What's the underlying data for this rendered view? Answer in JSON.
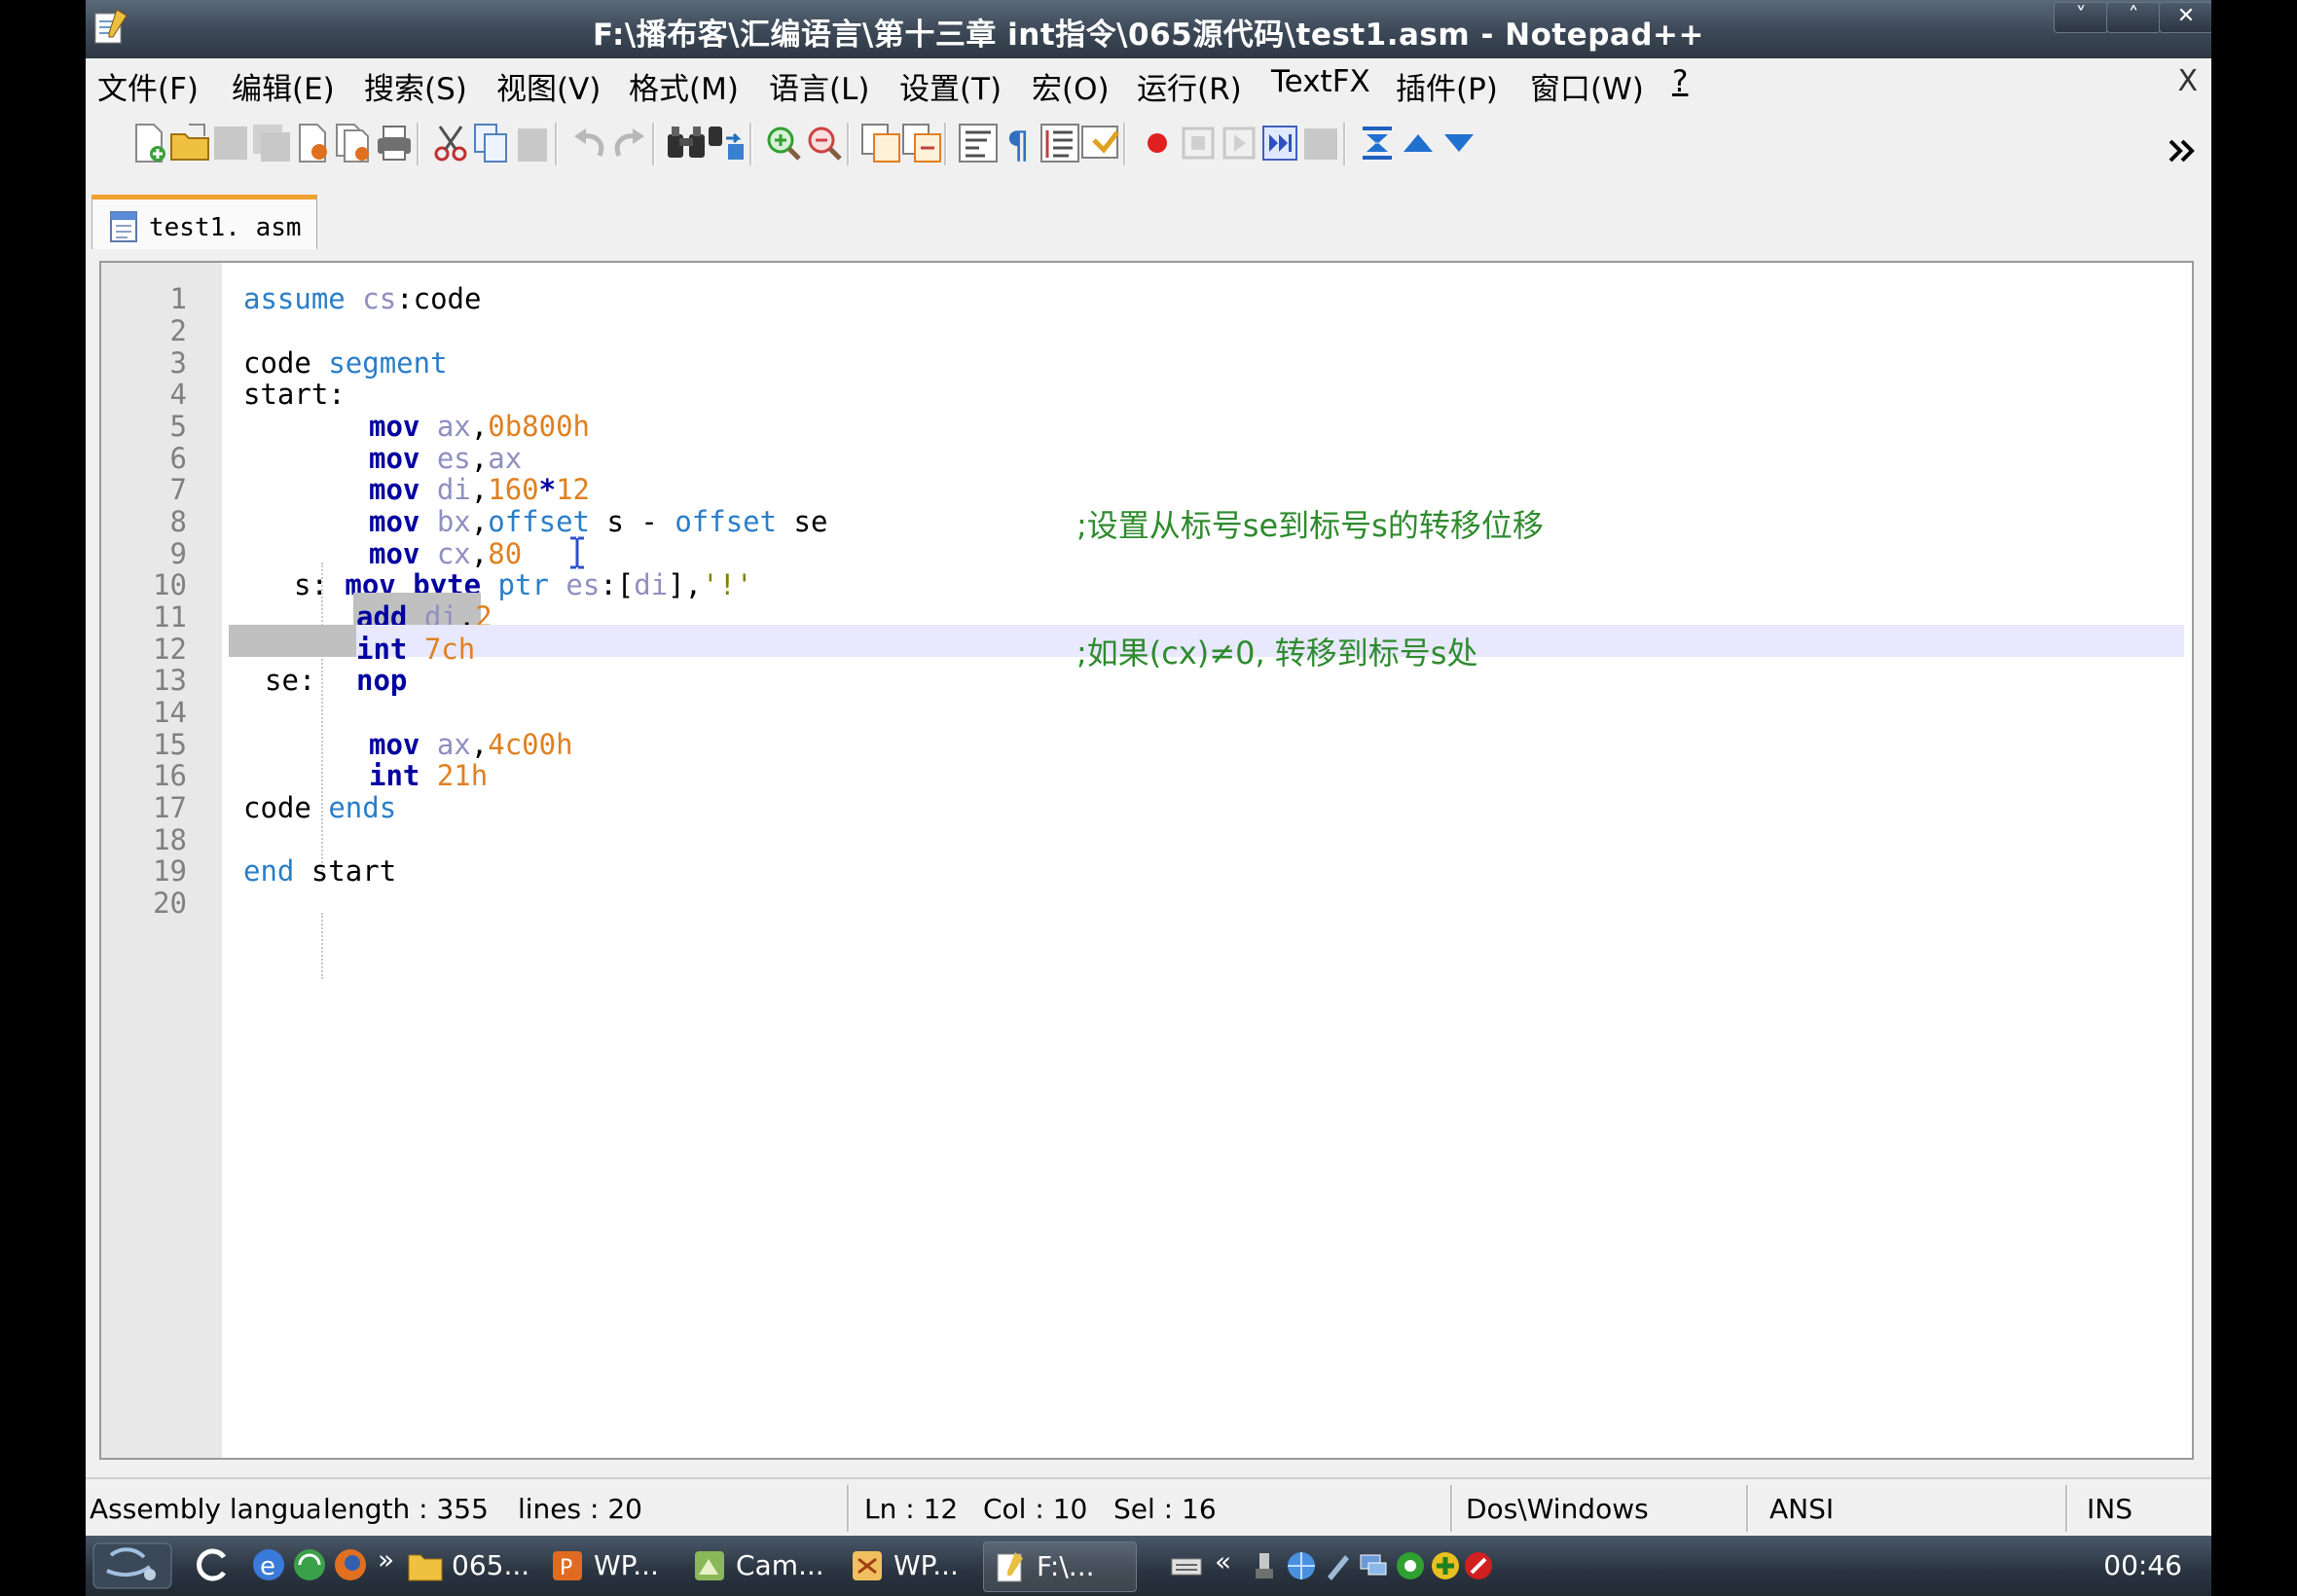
{
  "window": {
    "title": "F:\\播布客\\汇编语言\\第十三章 int指令\\065源代码\\test1.asm - Notepad++",
    "buttons": {
      "minimize": "˅",
      "maximize": "˄",
      "close": "✕"
    }
  },
  "menu": {
    "items": [
      "文件(F)",
      "编辑(E)",
      "搜索(S)",
      "视图(V)",
      "格式(M)",
      "语言(L)",
      "设置(T)",
      "宏(O)",
      "运行(R)",
      "TextFX",
      "插件(P)",
      "窗口(W)",
      "?"
    ],
    "close": "X"
  },
  "tabs": [
    {
      "label": "test1. asm",
      "active": true
    }
  ],
  "editor": {
    "language": "assembly",
    "current_line": 12,
    "lines": [
      {
        "n": "1"
      },
      {
        "n": "2"
      },
      {
        "n": "3"
      },
      {
        "n": "4"
      },
      {
        "n": "5"
      },
      {
        "n": "6"
      },
      {
        "n": "7"
      },
      {
        "n": "8"
      },
      {
        "n": "9"
      },
      {
        "n": "10"
      },
      {
        "n": "11"
      },
      {
        "n": "12"
      },
      {
        "n": "13"
      },
      {
        "n": "14"
      },
      {
        "n": "15"
      },
      {
        "n": "16"
      },
      {
        "n": "17"
      },
      {
        "n": "18"
      },
      {
        "n": "19"
      },
      {
        "n": "20"
      }
    ],
    "tokens": {
      "l1": [
        "assume",
        "cs",
        ":code"
      ],
      "l3": [
        "code ",
        "segment"
      ],
      "l4": [
        "start:"
      ],
      "l5": [
        "mov ",
        "ax",
        ",",
        "0b800h"
      ],
      "l6": [
        "mov ",
        "es",
        ",",
        "ax"
      ],
      "l7": [
        "mov ",
        "di",
        ",",
        "160",
        "*",
        "12"
      ],
      "l8": [
        "mov ",
        "bx",
        ",",
        "offset",
        " s - ",
        "offset",
        " se",
        ";设置从标号se到标号s的转移位移"
      ],
      "l9": [
        "mov ",
        "cx",
        ",",
        "80"
      ],
      "l10": [
        "s: ",
        "mov ",
        "byte ",
        "ptr",
        " ",
        "es",
        ":[",
        "di",
        "],",
        "'!'"
      ],
      "l11": [
        "add ",
        "di",
        ",",
        "2"
      ],
      "l12": [
        "int ",
        "7ch",
        ";如果(cx)≠0, 转移到标号s处"
      ],
      "l13": [
        "se:",
        "nop"
      ],
      "l15": [
        "mov ",
        "ax",
        ",",
        "4c00h"
      ],
      "l16": [
        "int ",
        "21h"
      ],
      "l17": [
        "code ",
        "ends"
      ],
      "l19": [
        "end",
        " start"
      ]
    }
  },
  "statusbar": {
    "lang": "Assembly languag",
    "length": "length : 355",
    "lines": "lines : 20",
    "ln": "Ln : 12",
    "col": "Col : 10",
    "sel": "Sel : 16",
    "eol": "Dos\\Windows",
    "encoding": "ANSI",
    "mode": "INS"
  },
  "taskbar": {
    "tasks": [
      "065...",
      "WP...",
      "Cam...",
      "WP...",
      "F:\\..."
    ],
    "overflow": "»",
    "tray_overflow": "«",
    "clock": "00:46"
  },
  "colors": {
    "keyword": "#0000a0",
    "type": "#2a7ec8",
    "register": "#8f8fc0",
    "number": "#e08020",
    "comment": "#2e8b2e",
    "current_line": "#e8e8ff",
    "selection": "#c0c0c0"
  }
}
